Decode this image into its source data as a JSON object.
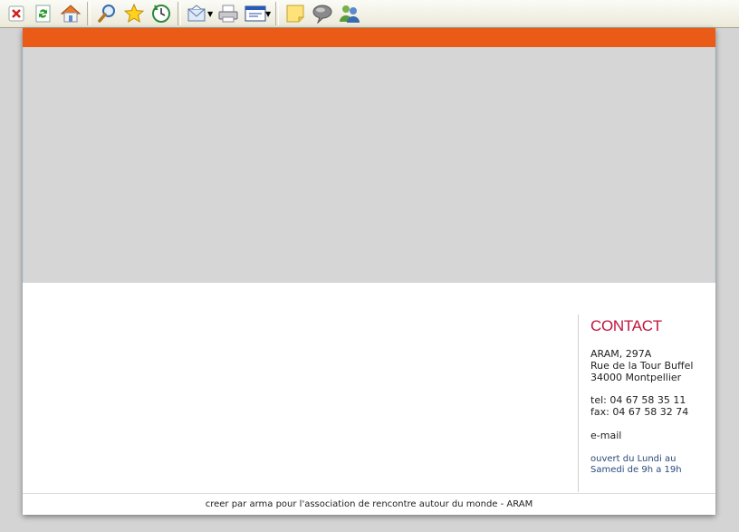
{
  "toolbar": {
    "buttons": [
      {
        "name": "stop-icon",
        "tooltip": ""
      },
      {
        "name": "refresh-icon",
        "tooltip": ""
      },
      {
        "name": "home-icon",
        "tooltip": ""
      },
      {
        "name": "search-icon",
        "tooltip": ""
      },
      {
        "name": "favorites-icon",
        "tooltip": ""
      },
      {
        "name": "history-icon",
        "tooltip": ""
      },
      {
        "name": "mail-icon",
        "tooltip": ""
      },
      {
        "name": "print-icon",
        "tooltip": ""
      },
      {
        "name": "edit-icon",
        "tooltip": ""
      },
      {
        "name": "note-icon",
        "tooltip": ""
      },
      {
        "name": "discuss-icon",
        "tooltip": ""
      },
      {
        "name": "messenger-icon",
        "tooltip": ""
      }
    ]
  },
  "colors": {
    "accent_bar": "#ea5b17",
    "contact_title": "#c0143c",
    "hours_text": "#2a4a7a",
    "banner": "#d6d6d6"
  },
  "contact": {
    "title": "CONTACT",
    "address_line1": "ARAM, 297A",
    "address_line2": "Rue de la Tour Buffel",
    "address_line3": "34000 Montpellier",
    "tel": "tel: 04 67 58 35 11",
    "fax": "fax: 04 67 58 32 74",
    "email": "e-mail",
    "hours_line1": "ouvert du Lundi au",
    "hours_line2": "Samedi de 9h a 19h"
  },
  "footer": {
    "text": "creer par arma pour l'association de rencontre autour du monde - ARAM"
  }
}
